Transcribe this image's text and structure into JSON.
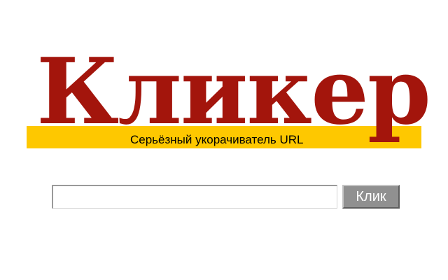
{
  "logo": {
    "word": "Кликер",
    "tagline": "Серьёзный укорачиватель URL"
  },
  "search": {
    "value": "",
    "placeholder": "",
    "button_label": "Клик"
  },
  "colors": {
    "logo_red": "#a3150c",
    "band_yellow": "#fec800",
    "button_gray": "#909090"
  }
}
